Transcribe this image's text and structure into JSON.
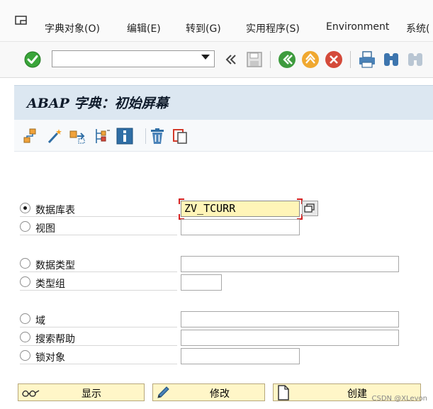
{
  "menubar": {
    "items": [
      {
        "label": "字典对象(O)"
      },
      {
        "label": "编辑(E)"
      },
      {
        "label": "转到(G)"
      },
      {
        "label": "实用程序(S)"
      },
      {
        "label": "Environment"
      },
      {
        "label": "系统("
      }
    ]
  },
  "toolbar": {
    "command_field_value": "",
    "icons": [
      "enter-icon",
      "command-dropdown-icon",
      "collapse-icon",
      "save-icon",
      "back-icon",
      "exit-icon",
      "cancel-icon",
      "print-icon",
      "find-icon",
      "find-next-icon"
    ]
  },
  "page": {
    "title": "ABAP 字典：初始屏幕"
  },
  "app_toolbar": {
    "icons": [
      "hierarchy-icon",
      "wizard-icon",
      "transfer-icon",
      "where-used-icon",
      "info-icon",
      "delete-icon",
      "copy-icon"
    ]
  },
  "form": {
    "options": [
      {
        "label": "数据库表",
        "value": "ZV_TCURR",
        "selected": true
      },
      {
        "label": "视图",
        "value": "",
        "selected": false
      },
      {
        "label": "数据类型",
        "value": "",
        "selected": false
      },
      {
        "label": "类型组",
        "value": "",
        "selected": false
      },
      {
        "label": "域",
        "value": "",
        "selected": false
      },
      {
        "label": "搜索帮助",
        "value": "",
        "selected": false
      },
      {
        "label": "锁对象",
        "value": "",
        "selected": false
      }
    ]
  },
  "buttons": {
    "display": "显示",
    "change": "修改",
    "create": "创建"
  },
  "watermark": "CSDN @XLevon",
  "colors": {
    "title_bg": "#dce7f1",
    "active_field_bg": "#fff5b8",
    "button_bg": "#fff6c8",
    "focus_red": "#d42020",
    "enter_green": "#3aa53a"
  }
}
